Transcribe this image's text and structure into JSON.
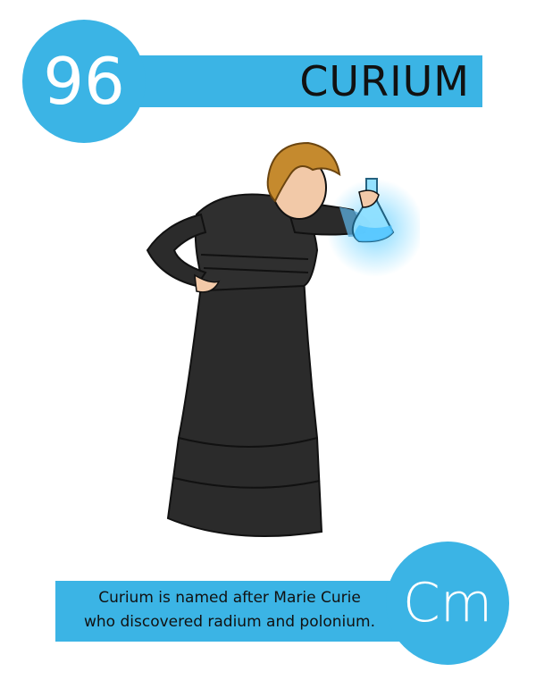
{
  "element": {
    "number": "96",
    "name": "CURIUM",
    "symbol": "Cm",
    "fact_line1": "Curium is named after Marie Curie",
    "fact_line2": "who discovered radium and polonium."
  },
  "colors": {
    "accent": "#3bb4e5",
    "dress": "#2b2b2b",
    "hair": "#c58a2e",
    "glow": "#6fd3ff"
  },
  "icons": {
    "illustration": "scientist-with-flask-illustration"
  }
}
